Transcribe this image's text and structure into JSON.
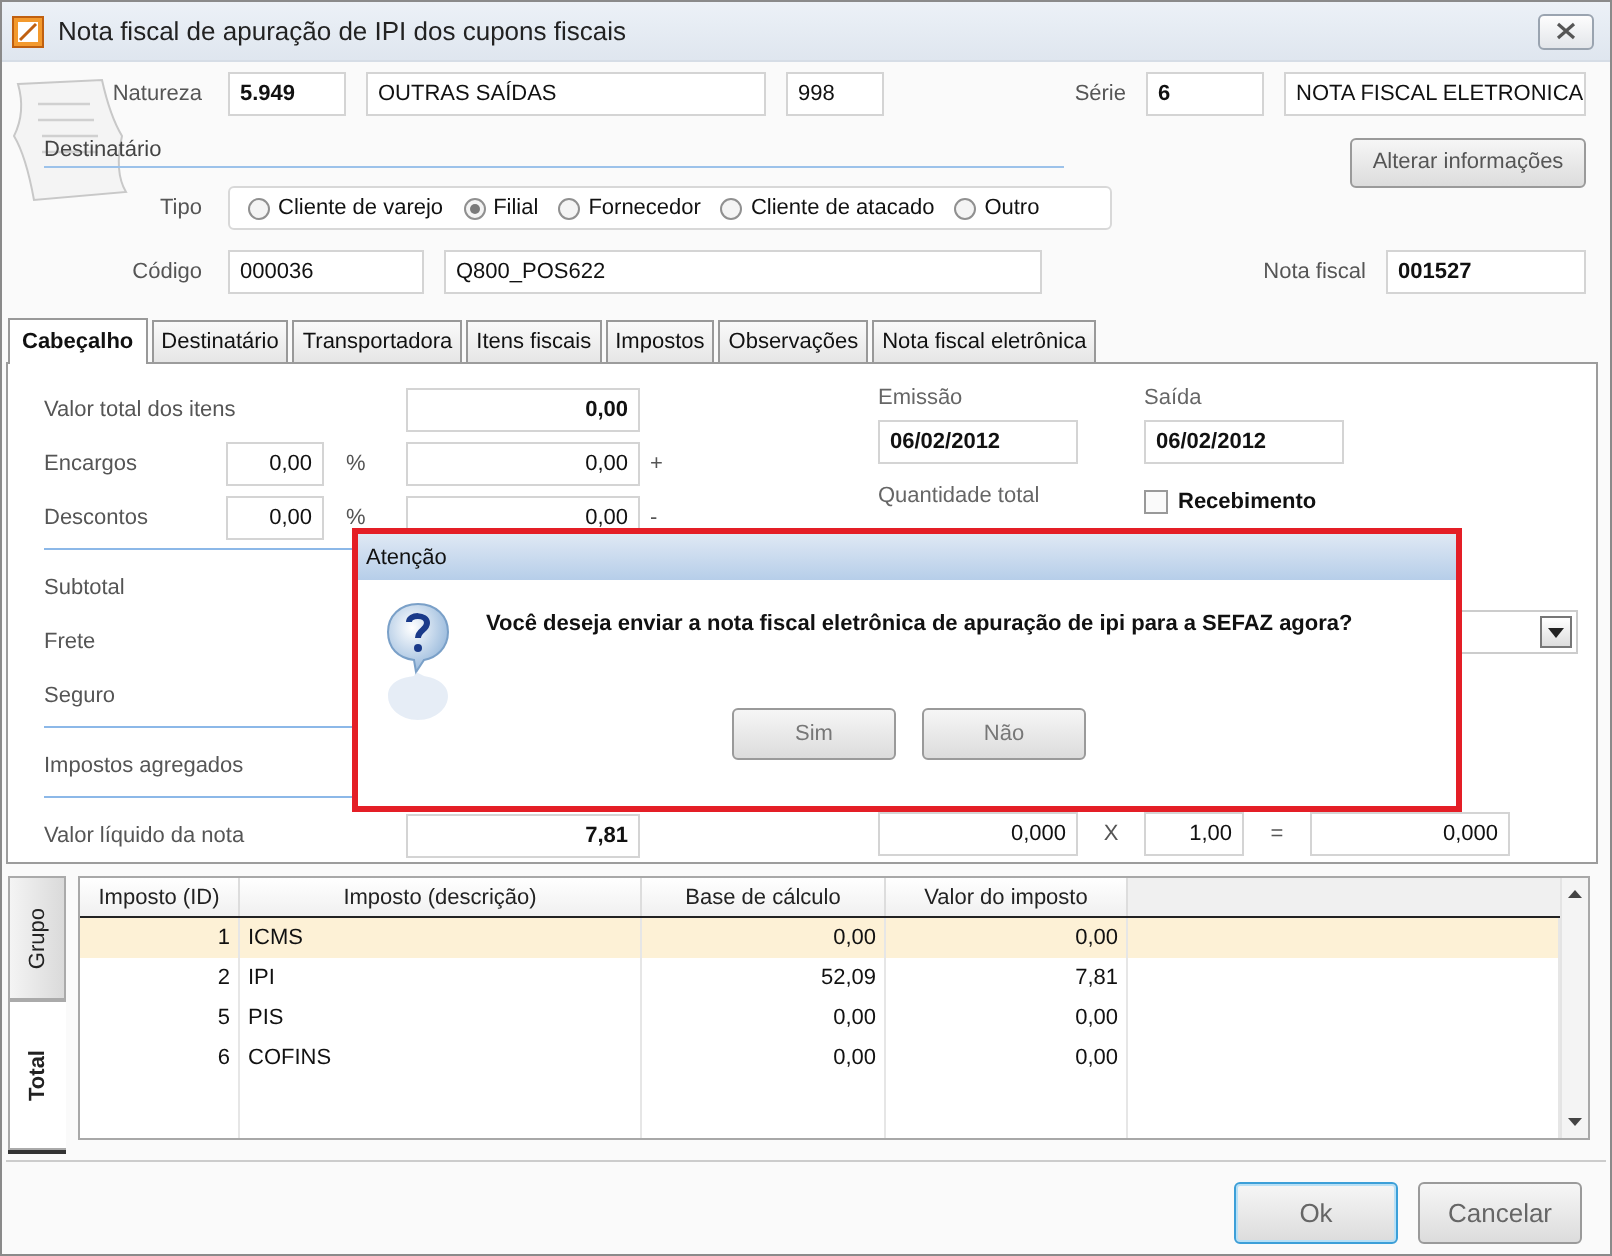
{
  "window": {
    "title": "Nota fiscal de apuração de IPI dos cupons fiscais"
  },
  "header": {
    "natureza": {
      "label": "Natureza",
      "code": "5.949",
      "description": "OUTRAS SAÍDAS",
      "number": "998"
    },
    "serie": {
      "label": "Série",
      "value": "6",
      "description": "NOTA FISCAL ELETRONICA"
    },
    "section_title": "Destinatário",
    "alter_button": "Alterar informações",
    "tipo": {
      "label": "Tipo",
      "options": [
        {
          "label": "Cliente de varejo",
          "selected": false
        },
        {
          "label": "Filial",
          "selected": true
        },
        {
          "label": "Fornecedor",
          "selected": false
        },
        {
          "label": "Cliente de atacado",
          "selected": false
        },
        {
          "label": "Outro",
          "selected": false
        }
      ]
    },
    "codigo": {
      "label": "Código",
      "code": "000036",
      "name": "Q800_POS622"
    },
    "nota_fiscal": {
      "label": "Nota fiscal",
      "value": "001527"
    }
  },
  "tabs": [
    {
      "label": "Cabeçalho",
      "selected": true
    },
    {
      "label": "Destinatário",
      "selected": false
    },
    {
      "label": "Transportadora",
      "selected": false
    },
    {
      "label": "Itens fiscais",
      "selected": false
    },
    {
      "label": "Impostos",
      "selected": false
    },
    {
      "label": "Observações",
      "selected": false
    },
    {
      "label": "Nota fiscal eletrônica",
      "selected": false
    }
  ],
  "total_groups": [
    {
      "rows": [
        {
          "kind": "total",
          "label": "Valor total dos itens",
          "value": "0,00"
        },
        {
          "kind": "percent",
          "label": "Encargos",
          "percent": "0,00",
          "percent_sign": "%",
          "value": "0,00",
          "sign": "+"
        },
        {
          "kind": "percent",
          "label": "Descontos",
          "percent": "0,00",
          "percent_sign": "%",
          "value": "0,00",
          "sign": "-"
        }
      ]
    },
    {
      "rows": [
        {
          "kind": "label_only",
          "label": "Subtotal"
        },
        {
          "kind": "label_only",
          "label": "Frete"
        },
        {
          "kind": "label_only",
          "label": "Seguro"
        }
      ]
    },
    {
      "rows": [
        {
          "kind": "label_only",
          "label": "Impostos agregados"
        }
      ]
    },
    {
      "rows": [
        {
          "kind": "total",
          "label": "Valor líquido da nota",
          "value": "7,81"
        }
      ]
    }
  ],
  "dates": {
    "emissao": {
      "label": "Emissão",
      "value": "06/02/2012"
    },
    "saida": {
      "label": "Saída",
      "value": "06/02/2012"
    }
  },
  "quantidade_total": {
    "label": "Quantidade total"
  },
  "recebimento": {
    "label": "Recebimento",
    "checked": false
  },
  "calculation": {
    "quantity": "0,000",
    "times": "X",
    "factor": "1,00",
    "equals": "=",
    "result": "0,000"
  },
  "dialog": {
    "title": "Atenção",
    "message": "Você deseja enviar a nota fiscal eletrônica de apuração de ipi para a SEFAZ agora?",
    "buttons": [
      "Sim",
      "Não"
    ]
  },
  "side_tabs": [
    {
      "label": "Grupo",
      "selected": false
    },
    {
      "label": "Total",
      "selected": true
    }
  ],
  "table": {
    "columns": [
      "Imposto (ID)",
      "Imposto (descrição)",
      "Base de cálculo",
      "Valor do imposto"
    ],
    "rows": [
      {
        "cells": [
          "1",
          "ICMS",
          "0,00",
          "0,00"
        ],
        "selected": true
      },
      {
        "cells": [
          "2",
          "IPI",
          "52,09",
          "7,81"
        ],
        "selected": false
      },
      {
        "cells": [
          "5",
          "PIS",
          "0,00",
          "0,00"
        ],
        "selected": false
      },
      {
        "cells": [
          "6",
          "COFINS",
          "0,00",
          "0,00"
        ],
        "selected": false
      }
    ]
  },
  "buttons": [
    {
      "label": "Ok",
      "kind": "default"
    },
    {
      "label": "Cancelar",
      "kind": "normal"
    }
  ]
}
